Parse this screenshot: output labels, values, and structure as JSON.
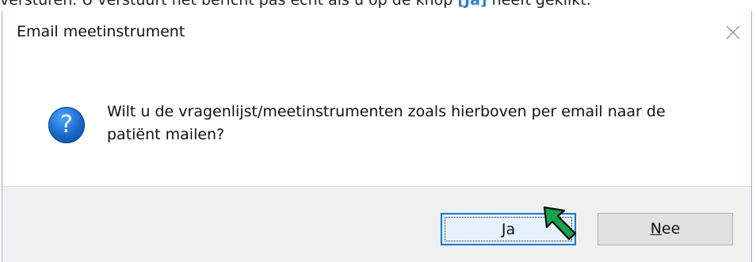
{
  "background_text": {
    "prefix": "versturen. U verstuurt het bericht pas echt als u op de knop",
    "keyword": "[Ja]",
    "suffix": "heeft geklikt."
  },
  "dialog": {
    "title": "Email meetinstrument",
    "message": "Wilt u de vragenlijst/meetinstrumenten zoals hierboven per email naar de patiënt mailen?",
    "icon": "question-icon",
    "buttons": {
      "yes_mnemonic": "J",
      "yes_rest": "a",
      "no_mnemonic": "N",
      "no_rest": "ee"
    }
  },
  "colors": {
    "accent": "#0078d7",
    "icon_blue": "#1766c8",
    "pointer_green": "#16a34a"
  }
}
